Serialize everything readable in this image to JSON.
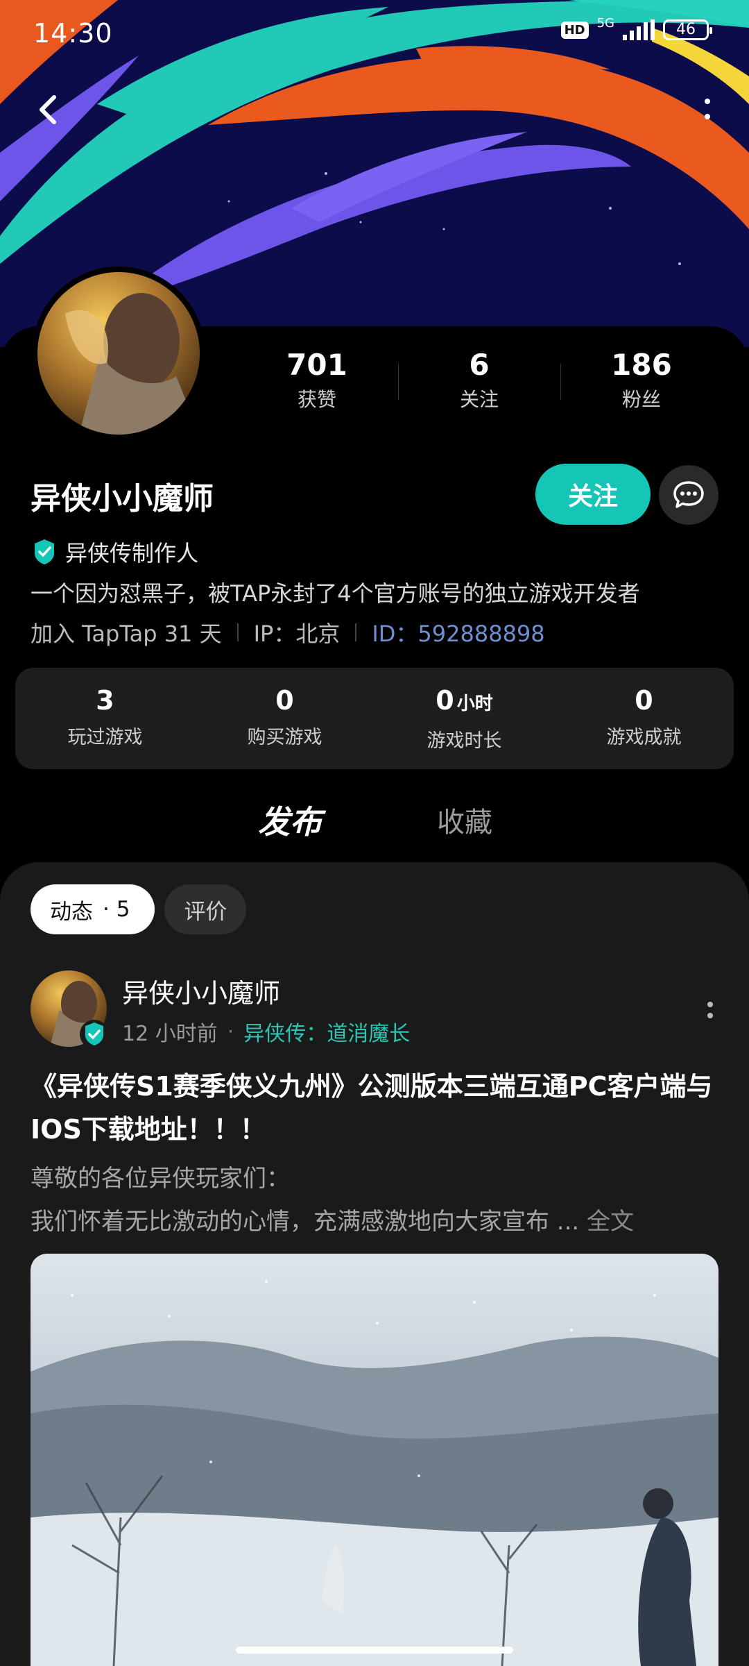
{
  "status_bar": {
    "time": "14:30",
    "hd": "HD",
    "network": "5G",
    "battery": "46"
  },
  "profile": {
    "stats": [
      {
        "value": "701",
        "label": "获赞"
      },
      {
        "value": "6",
        "label": "关注"
      },
      {
        "value": "186",
        "label": "粉丝"
      }
    ],
    "username": "异侠小小魔师",
    "follow_label": "关注",
    "verified_label": "异侠传制作人",
    "bio": "一个因为怼黑子，被TAP永封了4个官方账号的独立游戏开发者",
    "joined": "加入 TapTap 31 天",
    "ip": "IP：北京",
    "id": "ID：592888898"
  },
  "game_stats": [
    {
      "value": "3",
      "unit": "",
      "label": "玩过游戏"
    },
    {
      "value": "0",
      "unit": "",
      "label": "购买游戏"
    },
    {
      "value": "0",
      "unit": "小时",
      "label": "游戏时长"
    },
    {
      "value": "0",
      "unit": "",
      "label": "游戏成就"
    }
  ],
  "tabs": {
    "publish": "发布",
    "collect": "收藏"
  },
  "filters": {
    "feed_label": "动态",
    "feed_count": "· 5",
    "review_label": "评价"
  },
  "post": {
    "author": "异侠小小魔师",
    "time": "12 小时前",
    "dot": "·",
    "game": "异侠传：道消魔长",
    "title": "《异侠传S1赛季侠义九州》公测版本三端互通PC客户端与IOS下载地址！！！",
    "body_line1": "尊敬的各位异侠玩家们：",
    "body_line2": "我们怀着无比激动的心情，充满感激地向大家宣布 ...",
    "full_text": "全文"
  },
  "colors": {
    "accent": "#15c5b5",
    "id_link": "#6f8fd0",
    "game_tag": "#2cc7b4"
  },
  "icons": [
    "back-arrow-icon",
    "more-vertical-icon",
    "chat-bubble-icon",
    "verified-check-icon",
    "signal-icon",
    "battery-icon"
  ]
}
